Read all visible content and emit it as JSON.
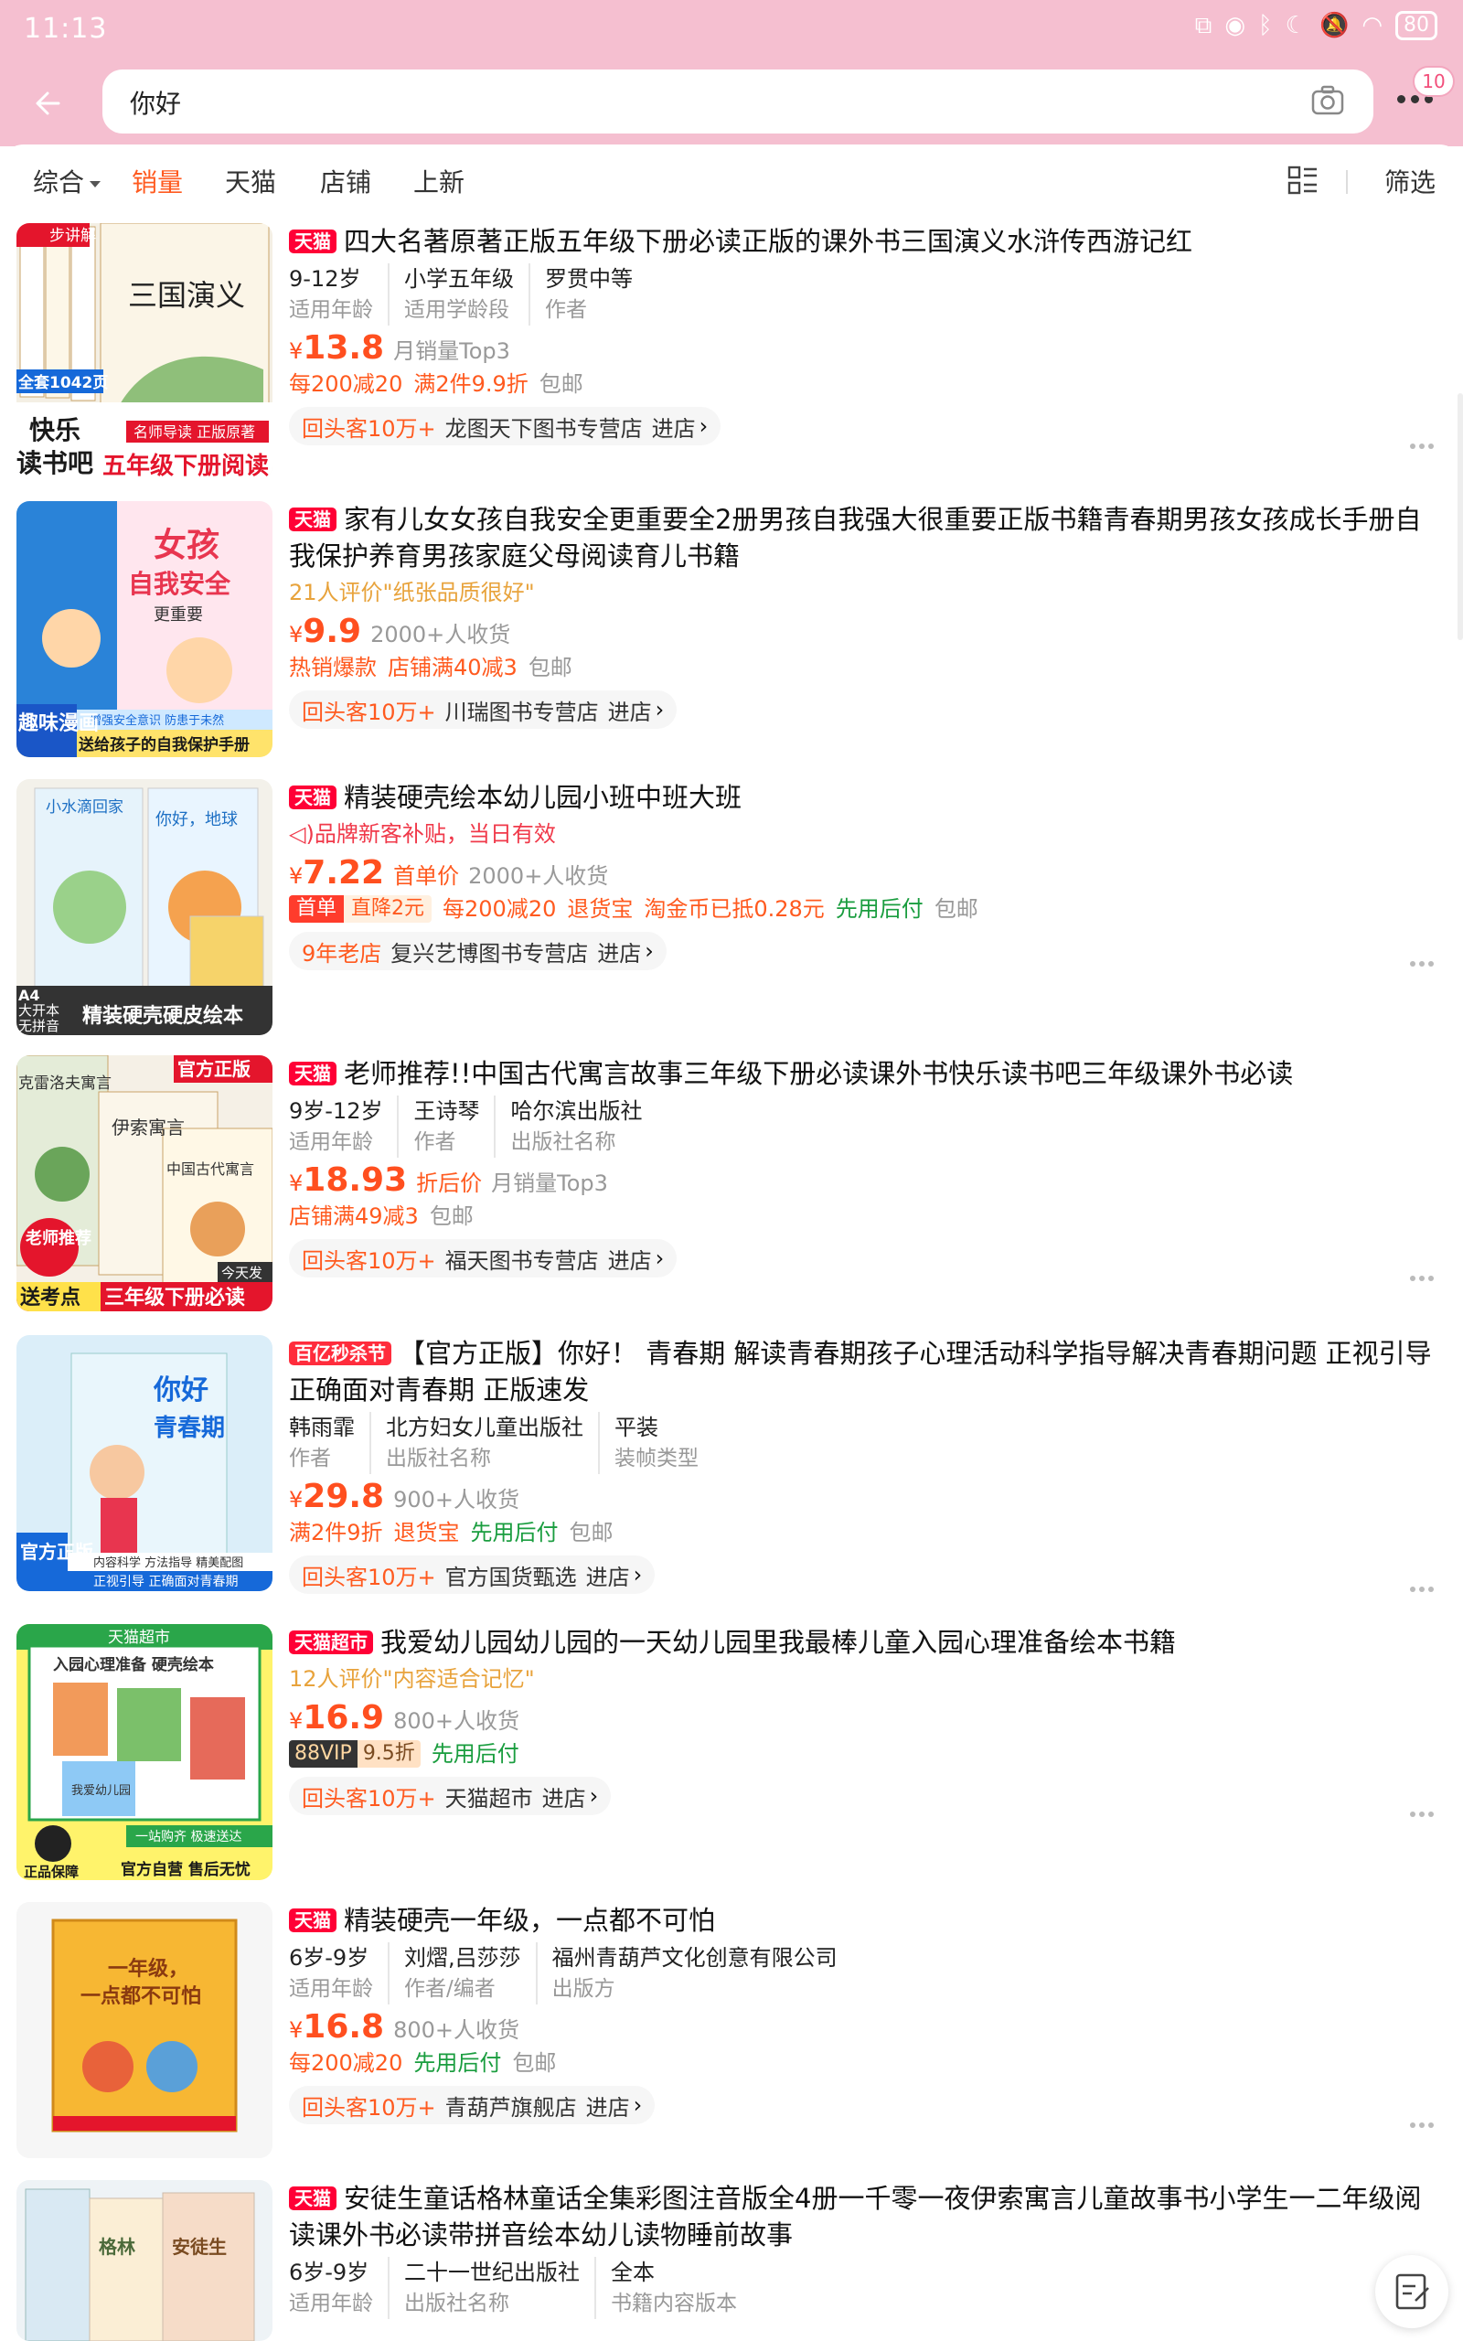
{
  "status_bar": {
    "time": "11:13",
    "battery": "80"
  },
  "search": {
    "query": "你好",
    "cart_badge": "10"
  },
  "sort_tabs": [
    "综合",
    "销量",
    "天猫",
    "店铺",
    "上新"
  ],
  "filter_label": "筛选",
  "colors": {
    "accent": "#ff5a1f",
    "header_pink": "#f5bfd0",
    "tmall_red": "#ff0036",
    "green": "#1a9d3f"
  },
  "products": [
    {
      "tag": "天猫",
      "title": "四大名著原著正版五年级下册必读正版的课外书三国演义水浒传西游记红",
      "attrs": [
        {
          "v": "9-12岁",
          "k": "适用年龄"
        },
        {
          "v": "小学五年级",
          "k": "适用学龄段"
        },
        {
          "v": "罗贯中等",
          "k": "作者"
        }
      ],
      "price": "13.8",
      "sales": "月销量Top3",
      "promos": [
        "每200减20",
        "满2件9.9折"
      ],
      "shipping": "包邮",
      "repeat": "回头客10万+",
      "shop": "龙图天下图书专营店",
      "enter": "进店",
      "thumb": {
        "label1": "快乐",
        "label2": "读书吧",
        "label3": "五年级下册阅读",
        "label4": "三国演义",
        "label5": "全套1042页",
        "label6": "名师导读 正版原著",
        "label7": "步讲解"
      }
    },
    {
      "tag": "天猫",
      "title": "家有儿女女孩自我安全更重要全2册男孩自我强大很重要正版书籍青春期男孩女孩成长手册自我保护养育男孩家庭父母阅读育儿书籍",
      "note": "21人评价\"纸张品质很好\"",
      "price": "9.9",
      "sales": "2000+人收货",
      "promos": [
        "热销爆款",
        "店铺满40减3"
      ],
      "shipping": "包邮",
      "repeat": "回头客10万+",
      "shop": "川瑞图书专营店",
      "enter": "进店",
      "thumb": {
        "label1": "女孩",
        "label2": "自我安全",
        "label3": "更重要",
        "label4": "趣味漫画",
        "label5": "送给孩子的自我保护手册",
        "label6": "增强安全意识 防患于未然"
      }
    },
    {
      "tag": "天猫",
      "title": "精装硬壳绘本幼儿园小班中班大班",
      "note": "品牌新客补贴，当日有效",
      "price": "7.22",
      "price_type": "首单价",
      "sales": "2000+人收货",
      "promo_box": "首单",
      "promo_box2": "直降2元",
      "promos": [
        "每200减20",
        "退货宝",
        "淘金币已抵0.28元"
      ],
      "promo_green": "先用后付",
      "shipping": "包邮",
      "repeat": "9年老店",
      "shop": "复兴艺博图书专营店",
      "enter": "进店",
      "thumb": {
        "label1": "A4",
        "label2": "大开本",
        "label3": "无拼音",
        "label4": "精装硬壳硬皮绘本",
        "label5": "小水滴回家",
        "label6": "你好，地球"
      }
    },
    {
      "tag": "天猫",
      "title": "老师推荐!!中国古代寓言故事三年级下册必读课外书快乐读书吧三年级课外书必读",
      "attrs": [
        {
          "v": "9岁-12岁",
          "k": "适用年龄"
        },
        {
          "v": "王诗琴",
          "k": "作者"
        },
        {
          "v": "哈尔滨出版社",
          "k": "出版社名称"
        }
      ],
      "price": "18.93",
      "price_type": "折后价",
      "sales": "月销量Top3",
      "promos": [
        "店铺满49减3"
      ],
      "shipping": "包邮",
      "repeat": "回头客10万+",
      "shop": "福天图书专营店",
      "enter": "进店",
      "thumb": {
        "label1": "官方正版",
        "label2": "老师推荐",
        "label3": "送考点",
        "label4": "三年级下册必读",
        "label5": "今天发",
        "label6": "伊索寓言",
        "label7": "中国古代寓言",
        "label8": "克雷洛夫寓言"
      }
    },
    {
      "tag": "百亿秒杀节",
      "title": "【官方正版】你好！ 青春期 解读青春期孩子心理活动科学指导解决青春期问题 正视引导正确面对青春期 正版速发",
      "attrs": [
        {
          "v": "韩雨霏",
          "k": "作者"
        },
        {
          "v": "北方妇女儿童出版社",
          "k": "出版社名称"
        },
        {
          "v": "平装",
          "k": "装帧类型"
        }
      ],
      "price": "29.8",
      "sales": "900+人收货",
      "promos": [
        "满2件9折",
        "退货宝"
      ],
      "promo_green": "先用后付",
      "shipping": "包邮",
      "repeat": "回头客10万+",
      "shop": "官方国货甄选",
      "enter": "进店",
      "thumb": {
        "label1": "你好",
        "label2": "青春期",
        "label3": "官方正版",
        "label4": "内容科学 方法指导 精美配图",
        "label5": "正视引导 正确面对青春期"
      }
    },
    {
      "tag": "天猫超市",
      "title": "我爱幼儿园幼儿园的一天幼儿园里我最棒儿童入园心理准备绘本书籍",
      "note": "12人评价\"内容适合记忆\"",
      "price": "16.9",
      "sales": "800+人收货",
      "vip": "88VIP",
      "vip_discount": "9.5折",
      "promo_green": "先用后付",
      "repeat": "回头客10万+",
      "shop": "天猫超市",
      "enter": "进店",
      "thumb": {
        "label1": "天猫超市",
        "label2": "入园心理准备 硬壳绘本",
        "label3": "我爱幼儿园",
        "label4": "一站购齐 极速送达",
        "label5": "正品保障",
        "label6": "官方自营 售后无忧"
      }
    },
    {
      "tag": "天猫",
      "title": "精装硬壳一年级，一点都不可怕",
      "attrs": [
        {
          "v": "6岁-9岁",
          "k": "适用年龄"
        },
        {
          "v": "刘熠,吕莎莎",
          "k": "作者/编者"
        },
        {
          "v": "福州青葫芦文化创意有限公司",
          "k": "出版方"
        }
      ],
      "price": "16.8",
      "sales": "800+人收货",
      "promos": [
        "每200减20"
      ],
      "promo_green": "先用后付",
      "shipping": "包邮",
      "repeat": "回头客10万+",
      "shop": "青葫芦旗舰店",
      "enter": "进店",
      "thumb": {
        "label1": "一年级，",
        "label2": "一点都不可怕"
      }
    },
    {
      "tag": "天猫",
      "title": "安徒生童话格林童话全集彩图注音版全4册一千零一夜伊索寓言儿童故事书小学生一二年级阅读课外书必读带拼音绘本幼儿读物睡前故事",
      "attrs": [
        {
          "v": "6岁-9岁",
          "k": "适用年龄"
        },
        {
          "v": "二十一世纪出版社",
          "k": "出版社名称"
        },
        {
          "v": "全本",
          "k": "书籍内容版本"
        }
      ],
      "thumb": {
        "label1": "格林",
        "label2": "安徒生"
      }
    }
  ]
}
